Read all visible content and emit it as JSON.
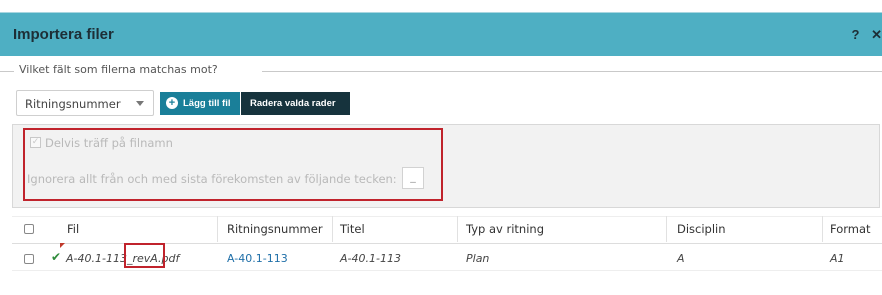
{
  "dialog": {
    "title": "Importera filer",
    "help_label": "?",
    "close_label": "✕"
  },
  "match_section": {
    "legend": "Vilket fält som filerna matchas mot?",
    "select_value": "Ritningsnummer",
    "add_file_label": "Lägg till fil",
    "delete_rows_label": "Radera valda rader"
  },
  "options": {
    "partial_match_label": "Delvis träff på filnamn",
    "partial_match_checked": true,
    "ignore_label": "Ignorera allt från och med sista förekomsten av följande tecken:",
    "ignore_char": "_"
  },
  "table": {
    "columns": [
      "Fil",
      "Ritningsnummer",
      "Titel",
      "Typ av ritning",
      "Disciplin",
      "Format"
    ],
    "rows": [
      {
        "file": "A-40.1-113_revA.pdf",
        "drawing_number": "A-40.1-113",
        "title": "A-40.1-113",
        "type": "Plan",
        "discipline": "A",
        "format": "A1",
        "status": "check-icon"
      }
    ]
  },
  "colors": {
    "titlebar": "#4eafc3",
    "add_button": "#1a7f99",
    "delete_button": "#16333d",
    "highlight_box": "#c0232c",
    "link": "#1f6fa8",
    "status_ok": "#2e8b3a"
  }
}
